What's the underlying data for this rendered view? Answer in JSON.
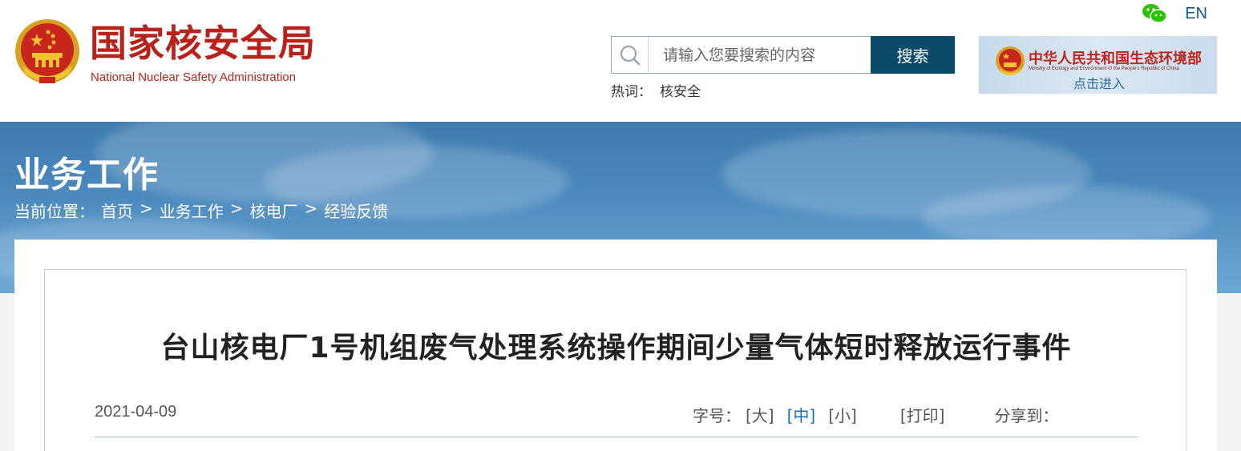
{
  "header": {
    "site_title": "国家核安全局",
    "site_subtitle": "National Nuclear Safety Administration",
    "wechat_icon": "wechat-icon",
    "lang_link": "EN",
    "search": {
      "placeholder": "请输入您要搜索的内容",
      "button_label": "搜索"
    },
    "hotwords": {
      "label": "热词：",
      "items": [
        "核安全"
      ]
    },
    "ministry": {
      "name": "中华人民共和国生态环境部",
      "english": "Ministry of Ecology and Environment of the People's Republic of China",
      "enter_label": "点击进入"
    }
  },
  "banner": {
    "section_title": "业务工作",
    "breadcrumb_label": "当前位置：",
    "breadcrumb": [
      "首页",
      "业务工作",
      "核电厂",
      "经验反馈"
    ],
    "separator": ">"
  },
  "article": {
    "title": "台山核电厂1号机组废气处理系统操作期间少量气体短时释放运行事件",
    "date": "2021-04-09",
    "font_size_label": "字号：",
    "font_size_options": [
      "[大]",
      "[中]",
      "[小]"
    ],
    "print_label": "[打印]",
    "share_label": "分享到："
  },
  "colors": {
    "brand_red": "#b7231b",
    "search_button": "#0b4a68",
    "banner_blue": "#4a88bd",
    "active_link": "#1d6eb5"
  }
}
